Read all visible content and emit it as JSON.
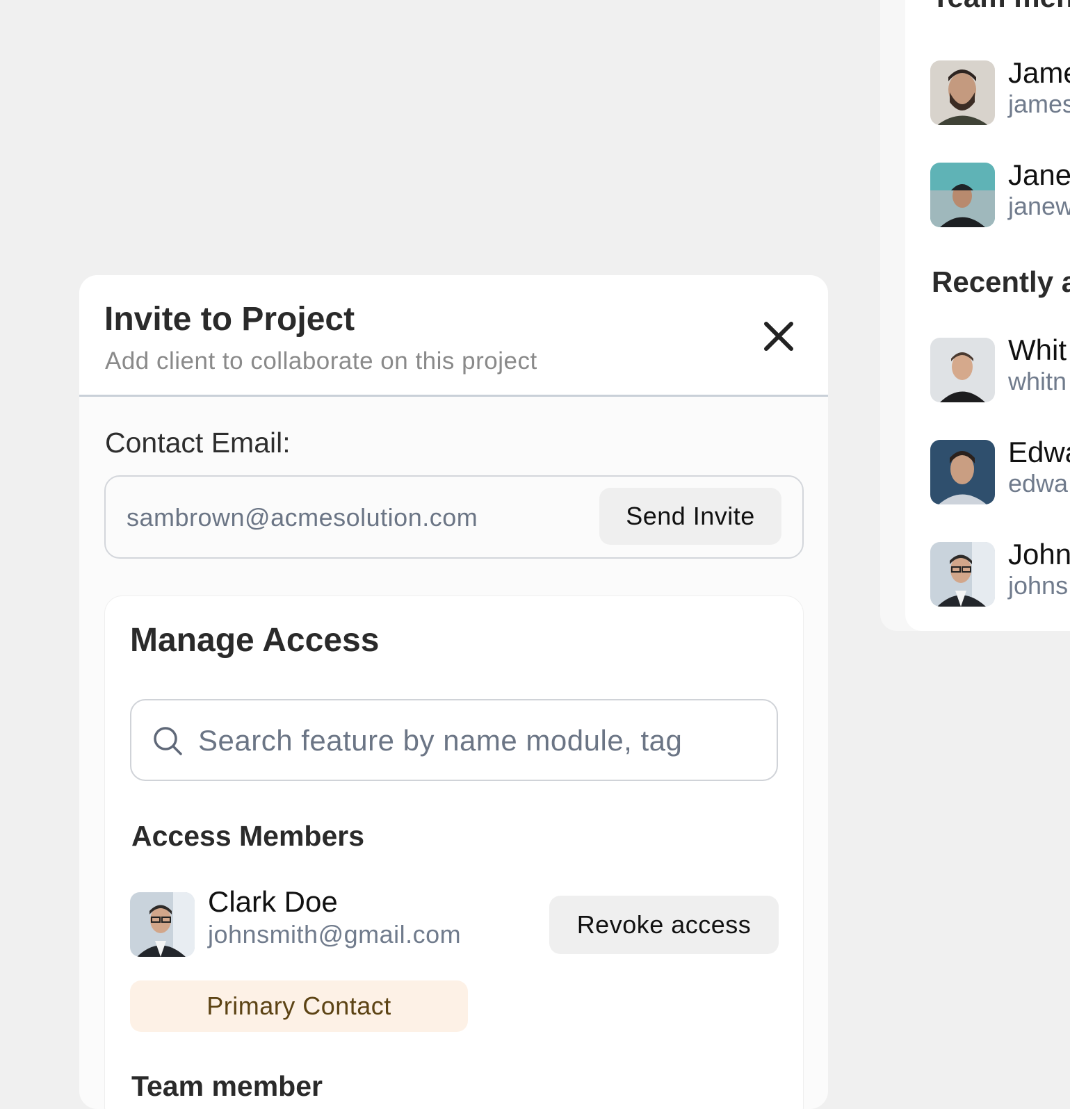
{
  "background_panel": {
    "team_heading": "Team men",
    "recent_heading": "Recently a",
    "team_members": [
      {
        "name": "Jame",
        "email": "james"
      },
      {
        "name": "Jane",
        "email": "janew"
      }
    ],
    "recent_members": [
      {
        "name": "Whit",
        "email": "whitn"
      },
      {
        "name": "Edwa",
        "email": "edwa"
      },
      {
        "name": "John",
        "email": "johns"
      }
    ]
  },
  "modal": {
    "title": "Invite to Project",
    "subtitle": "Add client to collaborate on this project",
    "contact_label": "Contact Email:",
    "email_value": "sambrown@acmesolution.com",
    "send_button": "Send Invite"
  },
  "manage_access": {
    "title": "Manage Access",
    "search_placeholder": "Search feature by name module, tag",
    "members_heading": "Access Members",
    "member": {
      "name": "Clark Doe",
      "email": "johnsmith@gmail.com",
      "revoke_label": "Revoke access",
      "badge": "Primary Contact"
    },
    "team_heading": "Team member"
  },
  "colors": {
    "background": "#f0f0f0",
    "badge_bg": "#fdf1e6",
    "badge_text": "#5c4314",
    "muted_text": "#707b8c"
  }
}
